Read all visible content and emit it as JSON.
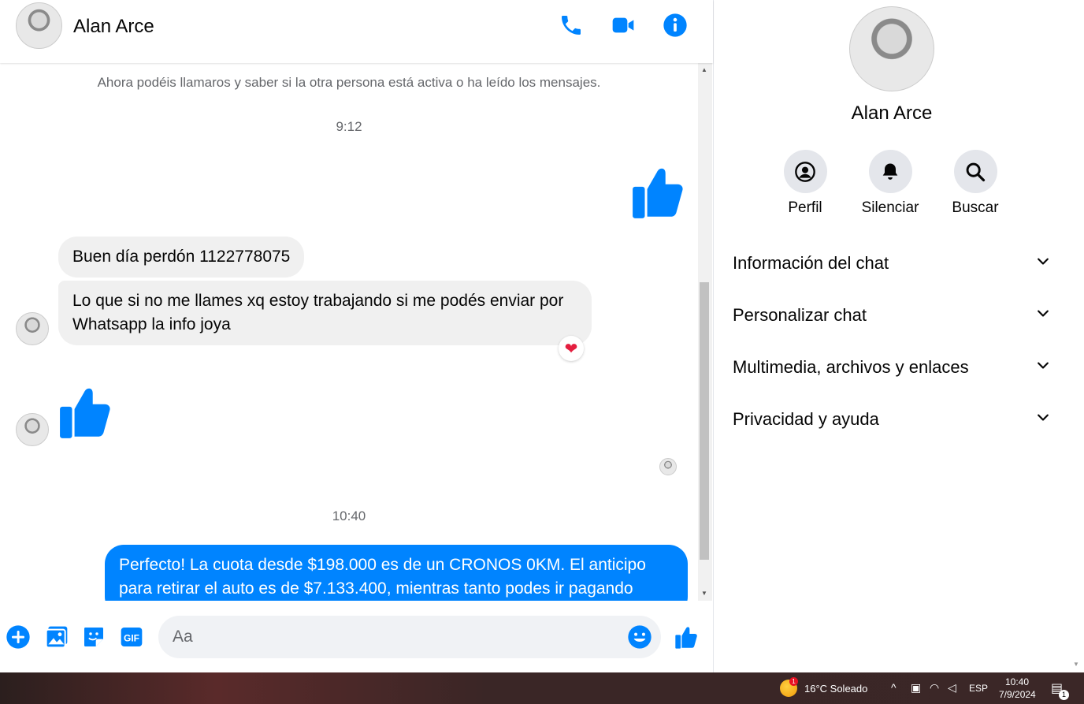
{
  "header": {
    "name": "Alan Arce"
  },
  "messages": {
    "notice": "Ahora podéis llamaros y saber si la otra persona está activa o ha leído los mensajes.",
    "time1": "9:12",
    "in1": "Buen día perdón 1122778075",
    "in2": "Lo que si no me llames xq estoy trabajando si me podés enviar por Whatsapp la info joya",
    "reaction": "❤",
    "time2": "10:40",
    "out1": "Perfecto! La cuota desde $198.000 es de un CRONOS 0KM. El anticipo para retirar el auto es de $7.133.400, mientras tanto podes ir pagando"
  },
  "composer": {
    "placeholder": "Aa"
  },
  "panel": {
    "name": "Alan Arce",
    "actions": [
      {
        "label": "Perfil",
        "icon": "user-circle-icon"
      },
      {
        "label": "Silenciar",
        "icon": "bell-icon"
      },
      {
        "label": "Buscar",
        "icon": "search-icon"
      }
    ],
    "sections": [
      "Información del chat",
      "Personalizar chat",
      "Multimedia, archivos y enlaces",
      "Privacidad y ayuda"
    ]
  },
  "taskbar": {
    "weather": "16°C  Soleado",
    "badge": "1",
    "lang": "ESP",
    "time": "10:40",
    "date": "7/9/2024",
    "notif_count": "1"
  },
  "colors": {
    "accent": "#0084ff",
    "incoming_bubble": "#f0f0f0",
    "heart": "#e41e3f"
  }
}
